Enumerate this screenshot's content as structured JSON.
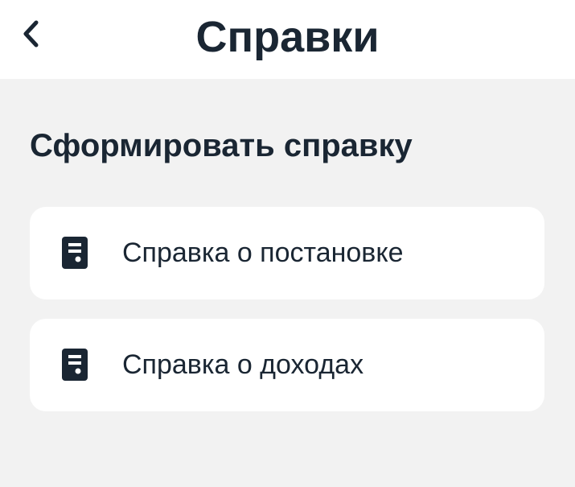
{
  "header": {
    "title": "Справки",
    "back_icon": "chevron-left-icon"
  },
  "section": {
    "title": "Сформировать справку"
  },
  "items": [
    {
      "label": "Справка о постановке",
      "icon": "document-icon"
    },
    {
      "label": "Справка о доходах",
      "icon": "document-icon"
    }
  ],
  "colors": {
    "background": "#f2f2f2",
    "surface": "#ffffff",
    "text": "#1a2633"
  }
}
